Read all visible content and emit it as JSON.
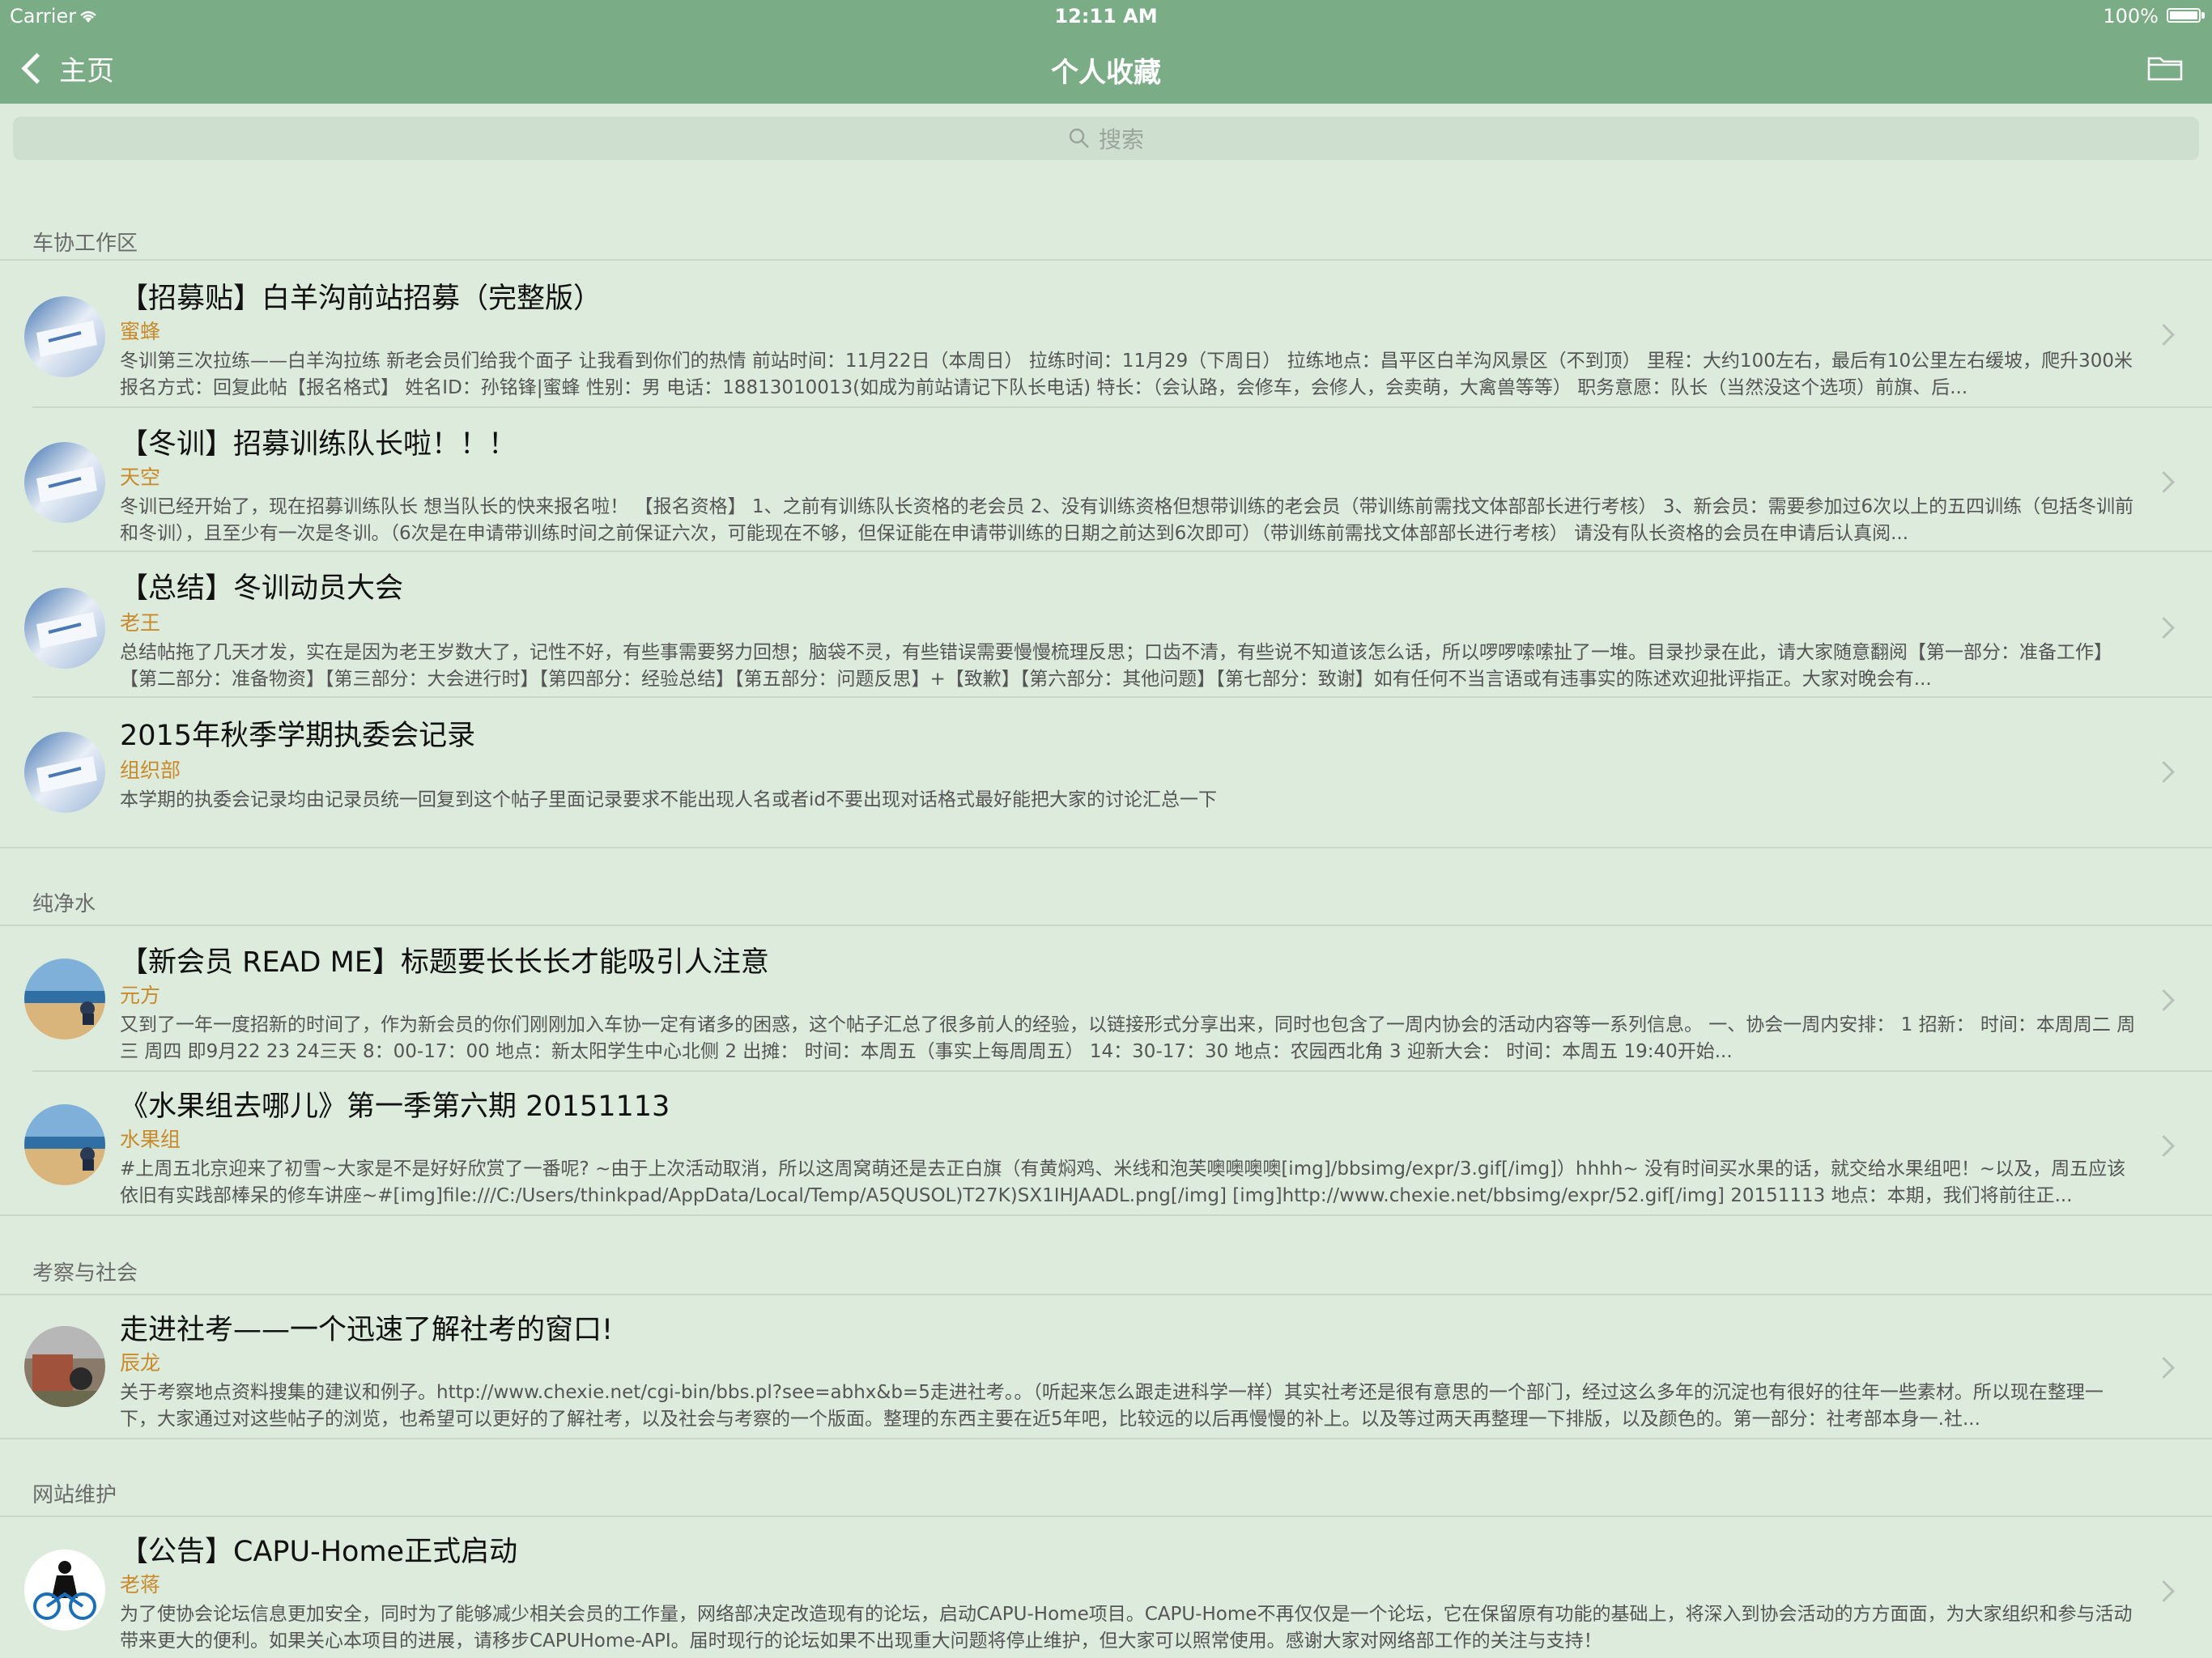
{
  "status": {
    "carrier": "Carrier",
    "time": "12:11 AM",
    "battery": "100%"
  },
  "nav": {
    "back_label": "主页",
    "title": "个人收藏"
  },
  "search": {
    "placeholder": "搜索"
  },
  "sections": [
    {
      "header": "车协工作区",
      "rows": [
        {
          "title": "【招募贴】白羊沟前站招募（完整版）",
          "author": "蜜蜂",
          "summary": "冬训第三次拉练——白羊沟拉练 新老会员们给我个面子 让我看到你们的热情  前站时间：11月22日（本周日）  拉练时间：11月29（下周日）  拉练地点：昌平区白羊沟风景区（不到顶）  里程：大约100左右，最后有10公里左右缓坡，爬升300米  报名方式：回复此帖【报名格式】 姓名ID：孙铭锋|蜜蜂 性别：男 电话：18813010013(如成为前站请记下队长电话) 特长：（会认路，会修车，会修人，会卖萌，大禽兽等等） 职务意愿：队长（当然没这个选项）前旗、后..."
        },
        {
          "title": "【冬训】招募训练队长啦！！！",
          "author": "天空",
          "summary": "冬训已经开始了，现在招募训练队长 想当队长的快来报名啦！    【报名资格】 1、之前有训练队长资格的老会员  2、没有训练资格但想带训练的老会员（带训练前需找文体部部长进行考核）   3、新会员：需要参加过6次以上的五四训练（包括冬训前和冬训），且至少有一次是冬训。（6次是在申请带训练时间之前保证六次，可能现在不够，但保证能在申请带训练的日期之前达到6次即可）（带训练前需找文体部部长进行考核）  请没有队长资格的会员在申请后认真阅..."
        },
        {
          "title": "【总结】冬训动员大会",
          "author": "老王",
          "summary": "总结帖拖了几天才发，实在是因为老王岁数大了，记性不好，有些事需要努力回想；脑袋不灵，有些错误需要慢慢梳理反思；口齿不清，有些说不知道该怎么话，所以啰啰嗦嗦扯了一堆。目录抄录在此，请大家随意翻阅【第一部分：准备工作】【第二部分：准备物资】【第三部分：大会进行时】【第四部分：经验总结】【第五部分：问题反思】+【致歉】【第六部分：其他问题】【第七部分：致谢】如有任何不当言语或有违事实的陈述欢迎批评指正。大家对晚会有..."
        },
        {
          "title": "2015年秋季学期执委会记录",
          "author": "组织部",
          "summary": "本学期的执委会记录均由记录员统一回复到这个帖子里面记录要求不能出现人名或者id不要出现对话格式最好能把大家的讨论汇总一下"
        }
      ]
    },
    {
      "header": "纯净水",
      "rows": [
        {
          "title": "【新会员 READ ME】标题要长长长才能吸引人注意",
          "author": "元方",
          "summary": "又到了一年一度招新的时间了，作为新会员的你们刚刚加入车协一定有诸多的困惑，这个帖子汇总了很多前人的经验，以链接形式分享出来，同时也包含了一周内协会的活动内容等一系列信息。  一、协会一周内安排： 1 招新：          时间：本周周二 周三 周四 即9月22 23 24三天 8：00-17：00         地点：新太阳学生中心北侧 2 出摊：          时间：本周五（事实上每周周五） 14：30-17：30         地点：农园西北角 3 迎新大会：          时间：本周五 19:40开始..."
        },
        {
          "title": "《水果组去哪儿》第一季第六期 20151113",
          "author": "水果组",
          "summary": "#上周五北京迎来了初雪~大家是不是好好欣赏了一番呢? ~由于上次活动取消，所以这周窝萌还是去正白旗（有黄焖鸡、米线和泡芙噢噢噢噢[img]/bbsimg/expr/3.gif[/img]）hhhh~ 没有时间买水果的话，就交给水果组吧！~以及，周五应该依旧有实践部棒呆的修车讲座~#[img]file:///C:/Users/thinkpad/AppData/Local/Temp/A5QUSOL)T27K)SX1IHJAADL.png[/img] [img]http://www.chexie.net/bbsimg/expr/52.gif[/img] 20151113   地点：本期，我们将前往正..."
        }
      ]
    },
    {
      "header": "考察与社会",
      "rows": [
        {
          "title": "走进社考——一个迅速了解社考的窗口!",
          "author": "辰龙",
          "summary": "关于考察地点资料搜集的建议和例子。http://www.chexie.net/cgi-bin/bbs.pl?see=abhx&b=5走进社考。。（听起来怎么跟走进科学一样）其实社考还是很有意思的一个部门，经过这么多年的沉淀也有很好的往年一些素材。所以现在整理一下，大家通过对这些帖子的浏览，也希望可以更好的了解社考，以及社会与考察的一个版面。整理的东西主要在近5年吧，比较远的以后再慢慢的补上。以及等过两天再整理一下排版，以及颜色的。第一部分：社考部本身一.社..."
        }
      ]
    },
    {
      "header": "网站维护",
      "rows": [
        {
          "title": "【公告】CAPU-Home正式启动",
          "author": "老蒋",
          "summary": "为了使协会论坛信息更加安全，同时为了能够减少相关会员的工作量，网络部决定改造现有的论坛，启动CAPU-Home项目。CAPU-Home不再仅仅是一个论坛，它在保留原有功能的基础上，将深入到协会活动的方方面面，为大家组织和参与活动带来更大的便利。如果关心本项目的进展，请移步CAPUHome-API。届时现行的论坛如果不出现重大问题将停止维护，但大家可以照常使用。感谢大家对网络部工作的关注与支持！"
        }
      ]
    }
  ],
  "colors": {
    "nav": "#7aac85",
    "background": "#dcebdc",
    "author": "#c98a2b"
  },
  "icons": {
    "back": "chevron-left-icon",
    "folder": "folder-icon",
    "search": "search-icon",
    "row": "chevron-right-icon"
  }
}
